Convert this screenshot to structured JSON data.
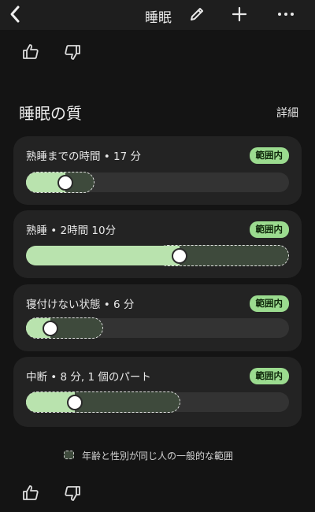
{
  "header": {
    "title": "睡眠",
    "back_icon": "chevron-left-icon",
    "edit_icon": "pencil-icon",
    "add_icon": "plus-icon",
    "more_icon": "more-horizontal-icon"
  },
  "feedback_top": {
    "like_icon": "thumbs-up-icon",
    "dislike_icon": "thumbs-down-icon"
  },
  "section": {
    "title": "睡眠の質",
    "details_label": "詳細"
  },
  "metrics": [
    {
      "label": "熟睡までの時間 • 17 分",
      "badge": "範囲内"
    },
    {
      "label": "熟睡 • 2時間 10分",
      "badge": "範囲内"
    },
    {
      "label": "寝付けない状態 • 6 分",
      "badge": "範囲内"
    },
    {
      "label": "中断 • 8 分, 1 個のパート",
      "badge": "範囲内"
    }
  ],
  "legend": {
    "text": "年齢と性別が同じ人の一般的な範囲"
  },
  "feedback_bottom": {
    "like_icon": "thumbs-up-icon",
    "dislike_icon": "thumbs-down-icon"
  },
  "colors": {
    "background": "#141414",
    "card": "#232323",
    "track": "#333333",
    "range": "#3e4a3c",
    "fill": "#b9e3ae",
    "badge": "#9bdb8f"
  }
}
